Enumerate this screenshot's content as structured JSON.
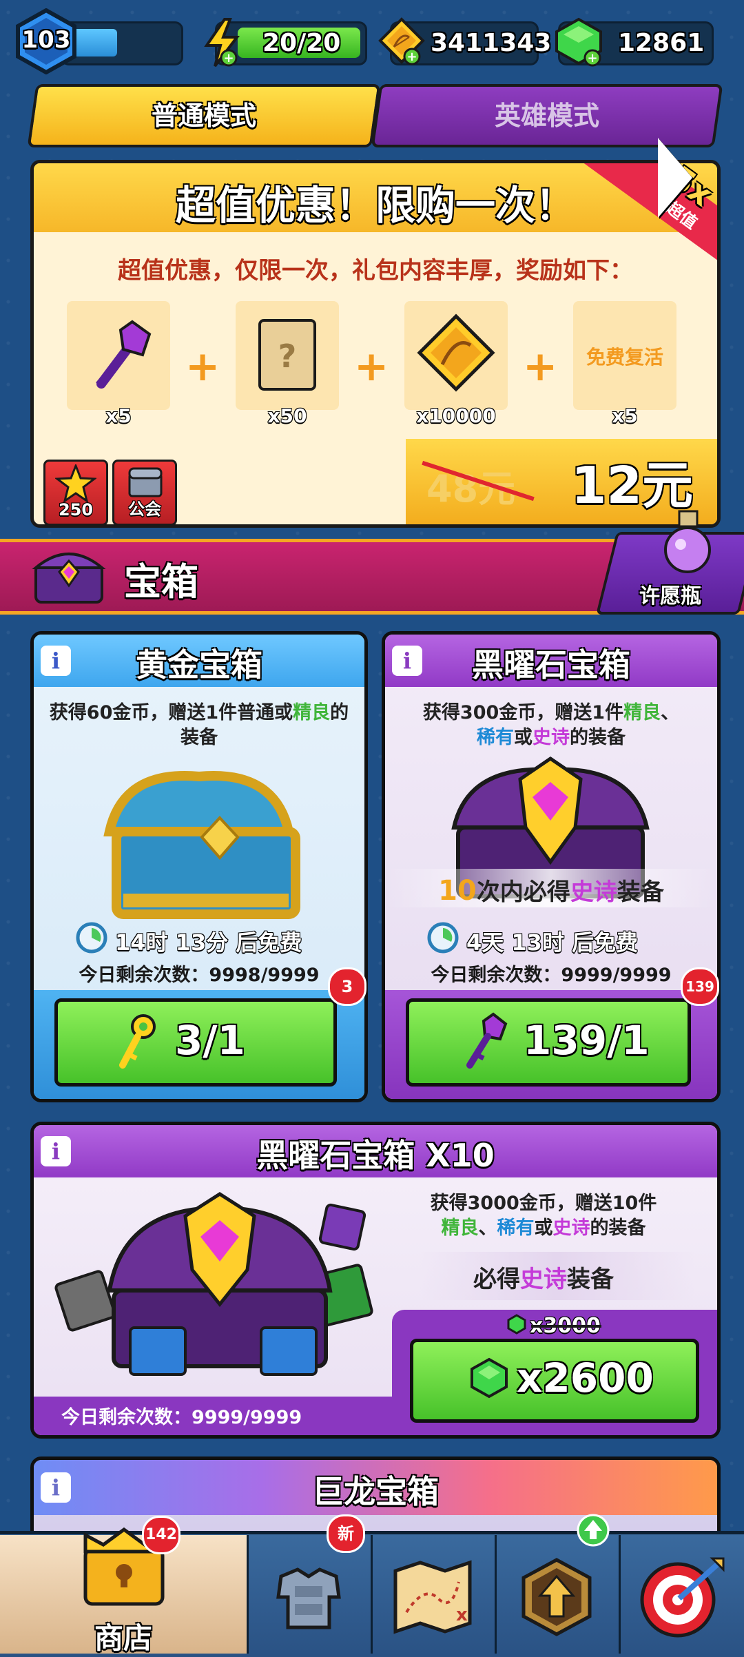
{
  "header": {
    "level": "103",
    "xp_fraction": 0.45,
    "energy": "20/20",
    "coins": "3411343",
    "gems": "12861"
  },
  "modes": {
    "normal": "普通模式",
    "hero": "英雄模式"
  },
  "offer": {
    "title": "超值优惠！限购一次！",
    "ribbon_multiplier": "5x",
    "ribbon_label": "超值",
    "subtitle": "超值优惠，仅限一次，礼包内容丰厚，奖励如下：",
    "items": [
      {
        "icon": "purple-key-icon",
        "qty": "x5"
      },
      {
        "icon": "scroll-icon",
        "qty": "x50"
      },
      {
        "icon": "bow-token-icon",
        "qty": "x10000"
      },
      {
        "icon": "revive-icon",
        "label": "免费复活",
        "qty": "x5"
      }
    ],
    "old_price": "48元",
    "new_price": "12元",
    "badges": [
      {
        "icon": "star-icon",
        "label": "250"
      },
      {
        "icon": "guild-chest-icon",
        "label": "公会"
      }
    ]
  },
  "section": {
    "title": "宝箱",
    "wish_label": "许愿瓶"
  },
  "gold_chest": {
    "title": "黄金宝箱",
    "desc_1": "获得60金币，赠送1件普通或",
    "desc_green": "精良",
    "desc_2": "的装备",
    "timer": "14时 13分 后免费",
    "remaining": "今日剩余次数：9998/9999",
    "badge": "3",
    "button": "3/1"
  },
  "obsidian_chest": {
    "title": "黑曜石宝箱",
    "desc_1": "获得300金币，赠送1件",
    "desc_green": "精良",
    "desc_sep": "、",
    "desc_blue": "稀有",
    "desc_or": "或",
    "desc_purple": "史诗",
    "desc_2": "的装备",
    "guarantee_num": "10",
    "guarantee_1": "次内必得",
    "guarantee_purple": "史诗",
    "guarantee_2": "装备",
    "timer": "4天 13时 后免费",
    "remaining": "今日剩余次数：9999/9999",
    "badge": "139",
    "button": "139/1"
  },
  "obsidian_x10": {
    "title": "黑曜石宝箱 X10",
    "desc_1": "获得3000金币，赠送10件",
    "desc_green": "精良",
    "desc_sep": "、",
    "desc_blue": "稀有",
    "desc_or": "或",
    "desc_purple": "史诗",
    "desc_2": "的装备",
    "guarantee_1": "必得",
    "guarantee_purple": "史诗",
    "guarantee_2": "装备",
    "old_price": "x3000",
    "price": "x2600",
    "remaining": "今日剩余次数：9999/9999"
  },
  "dragon_chest": {
    "title": "巨龙宝箱"
  },
  "nav": {
    "shop_label": "商店",
    "shop_badge": "142",
    "armor_badge": "新",
    "items": [
      "shop-icon",
      "armor-icon",
      "map-icon",
      "upgrade-icon",
      "target-icon"
    ]
  },
  "colors": {
    "gold": "#f6b729",
    "purple": "#8e3dc0",
    "green": "#47c22a",
    "red": "#e3232e",
    "background": "#1e4f86"
  }
}
